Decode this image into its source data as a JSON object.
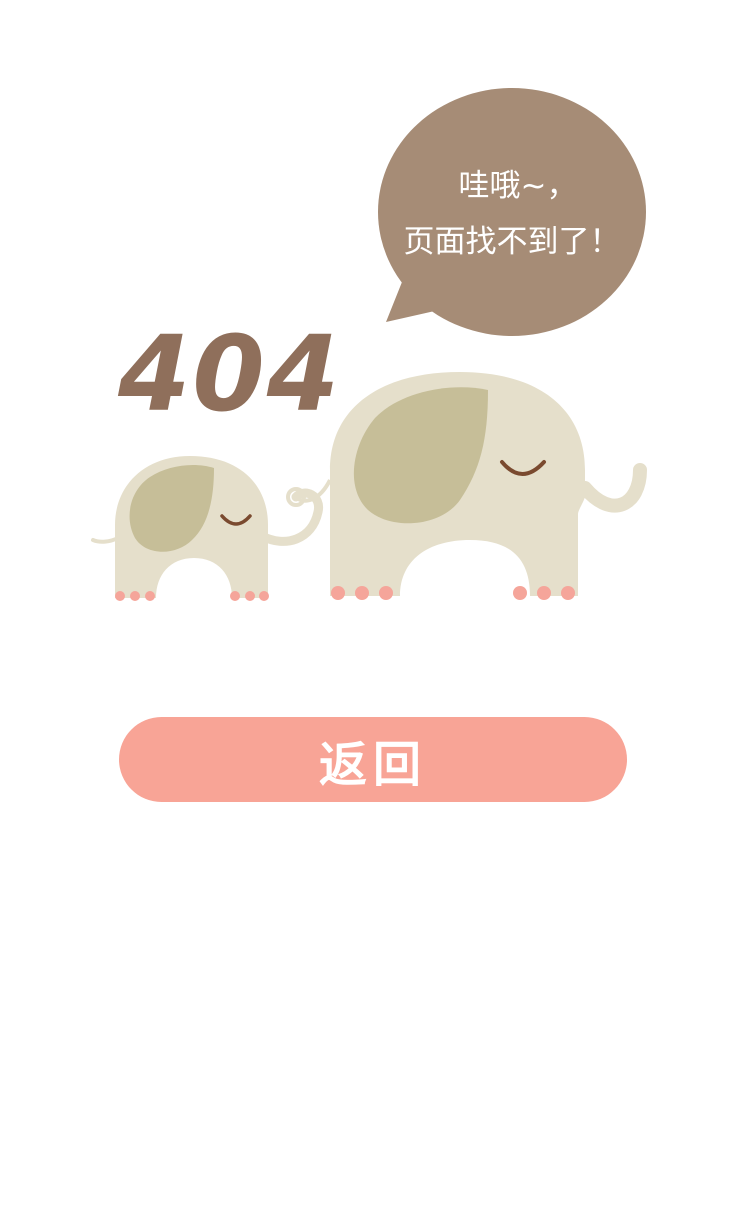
{
  "error": {
    "code": "404",
    "bubble_line1": "哇哦~，",
    "bubble_line2": "页面找不到了！"
  },
  "actions": {
    "back_label": "返回"
  },
  "colors": {
    "bubble": "#a68c76",
    "code_text": "#8f6f5b",
    "elephant_body": "#e5dfcb",
    "elephant_ear": "#c6be98",
    "elephant_eye": "#7a4a2f",
    "toes": "#f5a59a",
    "button": "#f8a496",
    "button_text": "#ffffff",
    "background": "#ffffff"
  }
}
